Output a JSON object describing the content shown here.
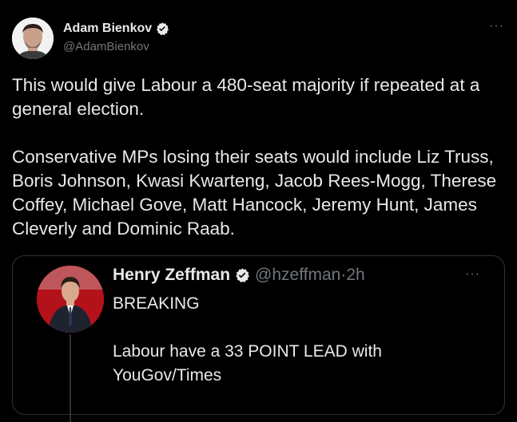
{
  "colors": {
    "background": "#000000",
    "text_primary": "#e7e9ea",
    "text_secondary": "#71767b",
    "border": "#2f3336",
    "verified": "#e7e9ea"
  },
  "tweet": {
    "author": {
      "name": "Adam Bienkov",
      "handle": "@AdamBienkov",
      "verified_icon": "verified-badge-icon",
      "avatar_icon": "avatar-photo"
    },
    "more_label": "···",
    "text": "This would give Labour a 480-seat majority if repeated at a general election.\n\nConservative MPs losing their seats would include Liz Truss, Boris Johnson, Kwasi Kwarteng, Jacob Rees-Mogg, Therese Coffey, Michael Gove, Matt Hancock, Jeremy Hunt, James Cleverly and Dominic Raab."
  },
  "quote": {
    "author": {
      "name": "Henry Zeffman",
      "handle": "@hzeffman",
      "separator": "·",
      "time": "2h",
      "verified_icon": "verified-badge-icon",
      "avatar_icon": "avatar-photo"
    },
    "more_label": "···",
    "text": "BREAKING\n\nLabour have a 33 POINT LEAD with YouGov/Times"
  }
}
